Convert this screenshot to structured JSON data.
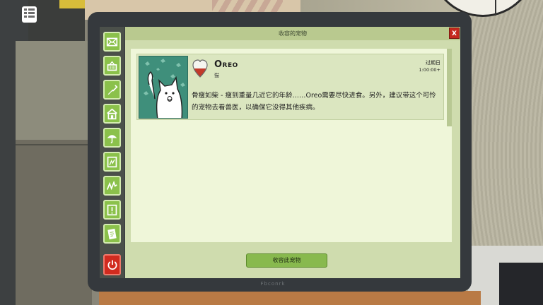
{
  "window": {
    "title": "收容的宠物",
    "close_label": "X"
  },
  "sidebar": {
    "items": [
      {
        "icon": "mail-icon"
      },
      {
        "icon": "shop-basket-icon"
      },
      {
        "icon": "shovel-icon"
      },
      {
        "icon": "shelter-house-icon"
      },
      {
        "icon": "umbrella-icon"
      },
      {
        "icon": "pet-photo-icon"
      },
      {
        "icon": "stats-graph-icon"
      },
      {
        "icon": "alert-icon"
      },
      {
        "icon": "notes-icon"
      }
    ],
    "power": {
      "icon": "power-icon"
    }
  },
  "pet": {
    "name": "Oreo",
    "species": "猫",
    "expiry_label": "过期日",
    "expiry_value": "1:00:00+",
    "description": "骨瘦如柴 - 瘦到重量几近它的年龄……Oreo需要尽快进食。另外，建议带这个可怜的宠物去看兽医，以确保它没得其他疾病。",
    "heart_icon": "health-heart-icon",
    "heart_fill": 0.5
  },
  "actions": {
    "adopt_label": "收容此宠物"
  },
  "monitor": {
    "brand": "Fbconrk"
  },
  "hud": {
    "menu_icon": "menu-list-icon"
  },
  "colors": {
    "accent_green": "#88b94e",
    "close_red": "#c4281d",
    "power_red": "#d12b1f",
    "screen_bg": "#cfdcae",
    "panel_bg": "#eff6d9"
  }
}
